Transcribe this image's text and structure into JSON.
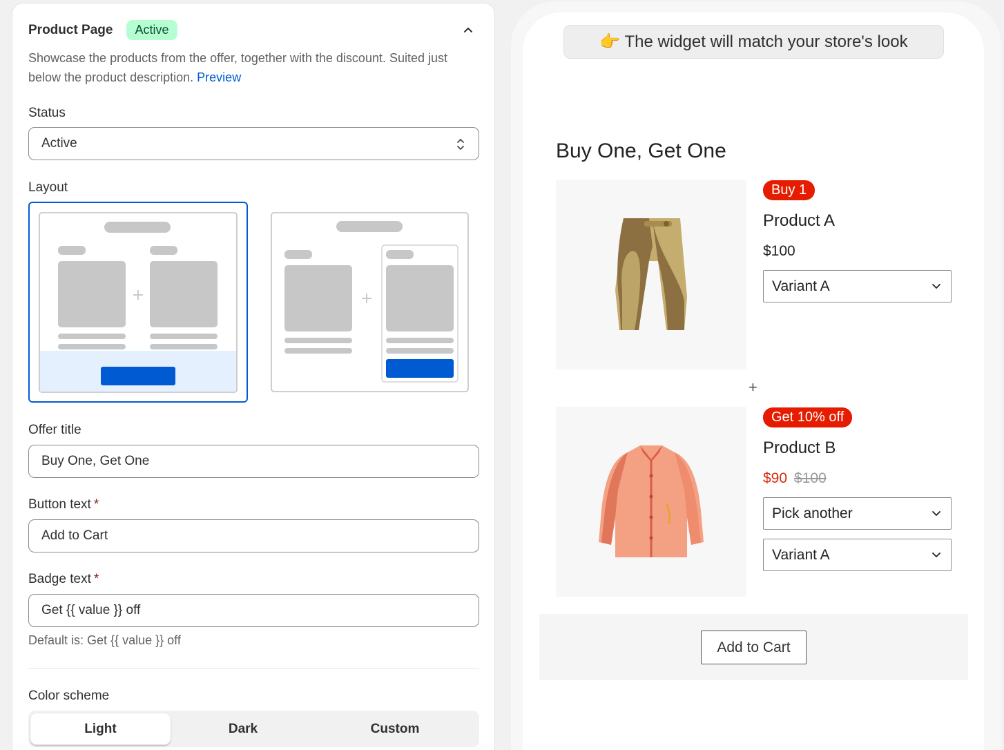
{
  "settings": {
    "title": "Product Page",
    "status_badge": "Active",
    "description": "Showcase the products from the offer, together with the discount. Suited just below the product description.",
    "preview_link": "Preview",
    "status": {
      "label": "Status",
      "value": "Active"
    },
    "layout": {
      "label": "Layout",
      "selected": 1
    },
    "offer_title": {
      "label": "Offer title",
      "value": "Buy One, Get One"
    },
    "button_text": {
      "label": "Button text",
      "required_mark": "*",
      "value": "Add to Cart"
    },
    "badge_text": {
      "label": "Badge text",
      "required_mark": "*",
      "value": "Get {{ value }} off",
      "helper": "Default is: Get {{ value }} off"
    },
    "color_scheme": {
      "label": "Color scheme",
      "options": [
        "Light",
        "Dark",
        "Custom"
      ],
      "selected": "Light"
    }
  },
  "preview": {
    "notice": "👉 The widget will match your store's look",
    "offer_title": "Buy One, Get One",
    "plus": "+",
    "products": [
      {
        "badge": "Buy 1",
        "name": "Product A",
        "price": "$100",
        "compare_price": "",
        "selects": [
          "Variant A"
        ],
        "icon": "pants-icon"
      },
      {
        "badge": "Get 10% off",
        "name": "Product B",
        "price": "$90",
        "compare_price": "$100",
        "selects": [
          "Pick another",
          "Variant A"
        ],
        "icon": "shirt-icon"
      }
    ],
    "cart_button": "Add to Cart"
  },
  "colors": {
    "accent": "#005bd3",
    "badge_green_bg": "#b4fed2",
    "badge_red": "#e51c00",
    "sale_price": "#d72c0d"
  }
}
